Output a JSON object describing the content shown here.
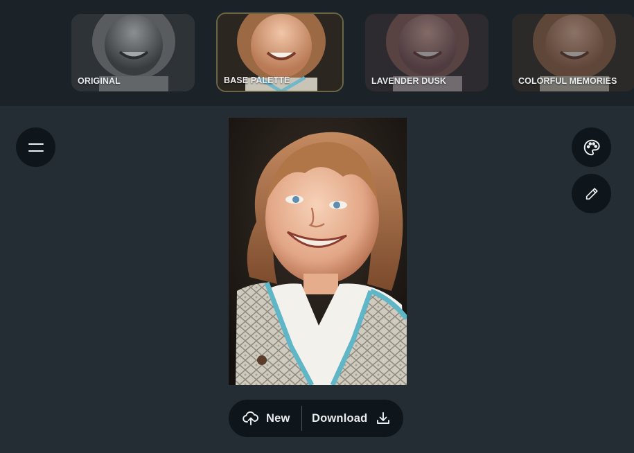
{
  "filters": [
    {
      "label": "ORIGINAL",
      "selected": false
    },
    {
      "label": "BASE PALETTE",
      "selected": true
    },
    {
      "label": "LAVENDER DUSK",
      "selected": false
    },
    {
      "label": "COLORFUL MEMORIES",
      "selected": false
    }
  ],
  "actions": {
    "new_label": "New",
    "download_label": "Download"
  },
  "icons": {
    "menu": "menu-icon",
    "palette": "palette-icon",
    "edit": "pencil-icon",
    "upload": "cloud-upload-icon",
    "download": "download-icon"
  },
  "colors": {
    "background": "#242d33",
    "strip": "#1b2328",
    "button": "#0f161b",
    "selected_border": "#6b6746"
  }
}
